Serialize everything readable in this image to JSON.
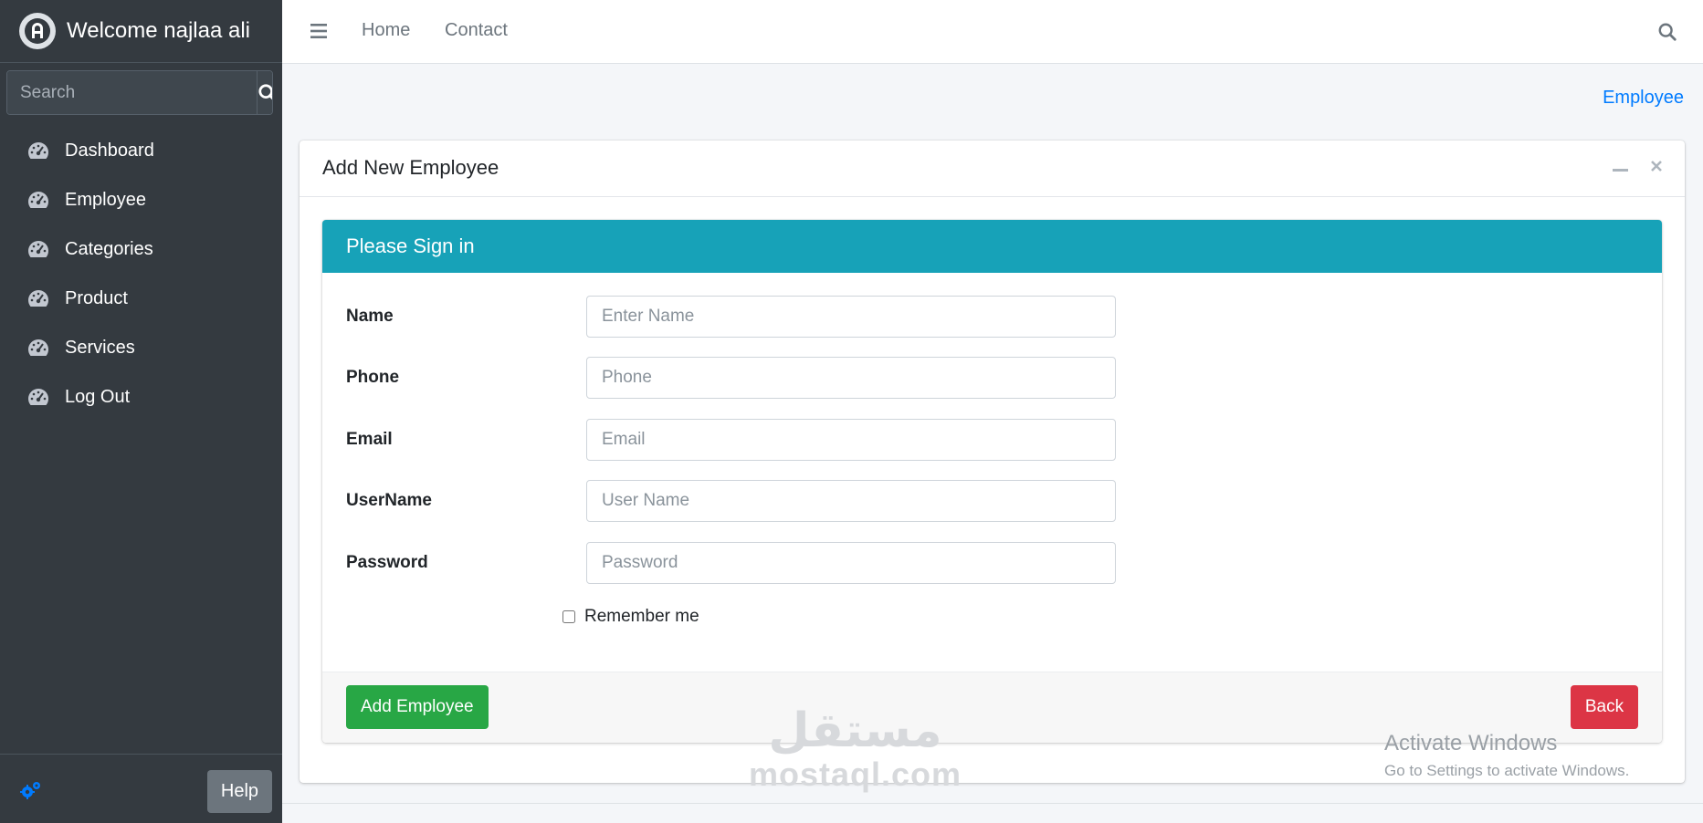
{
  "sidebar": {
    "brand_text": "Welcome najlaa ali",
    "search_placeholder": "Search",
    "items": [
      {
        "label": "Dashboard"
      },
      {
        "label": "Employee"
      },
      {
        "label": "Categories"
      },
      {
        "label": "Product"
      },
      {
        "label": "Services"
      },
      {
        "label": "Log Out"
      }
    ],
    "help_label": "Help"
  },
  "topbar": {
    "links": [
      "Home",
      "Contact"
    ]
  },
  "breadcrumb": "Employee",
  "card": {
    "title": "Add New Employee",
    "panel_title": "Please Sign in",
    "fields": [
      {
        "label": "Name",
        "placeholder": "Enter Name"
      },
      {
        "label": "Phone",
        "placeholder": "Phone"
      },
      {
        "label": "Email",
        "placeholder": "Email"
      },
      {
        "label": "UserName",
        "placeholder": "User Name"
      },
      {
        "label": "Password",
        "placeholder": "Password"
      }
    ],
    "remember_label": "Remember me",
    "add_button": "Add Employee",
    "back_button": "Back"
  },
  "watermark": {
    "arabic": "مستقل",
    "latin": "mostaql.com"
  },
  "activate": {
    "line1": "Activate Windows",
    "line2": "Go to Settings to activate Windows."
  },
  "colors": {
    "sidebar": "#343a40",
    "info": "#17a2b8",
    "success": "#28a745",
    "danger": "#dc3545",
    "primary": "#007bff"
  }
}
